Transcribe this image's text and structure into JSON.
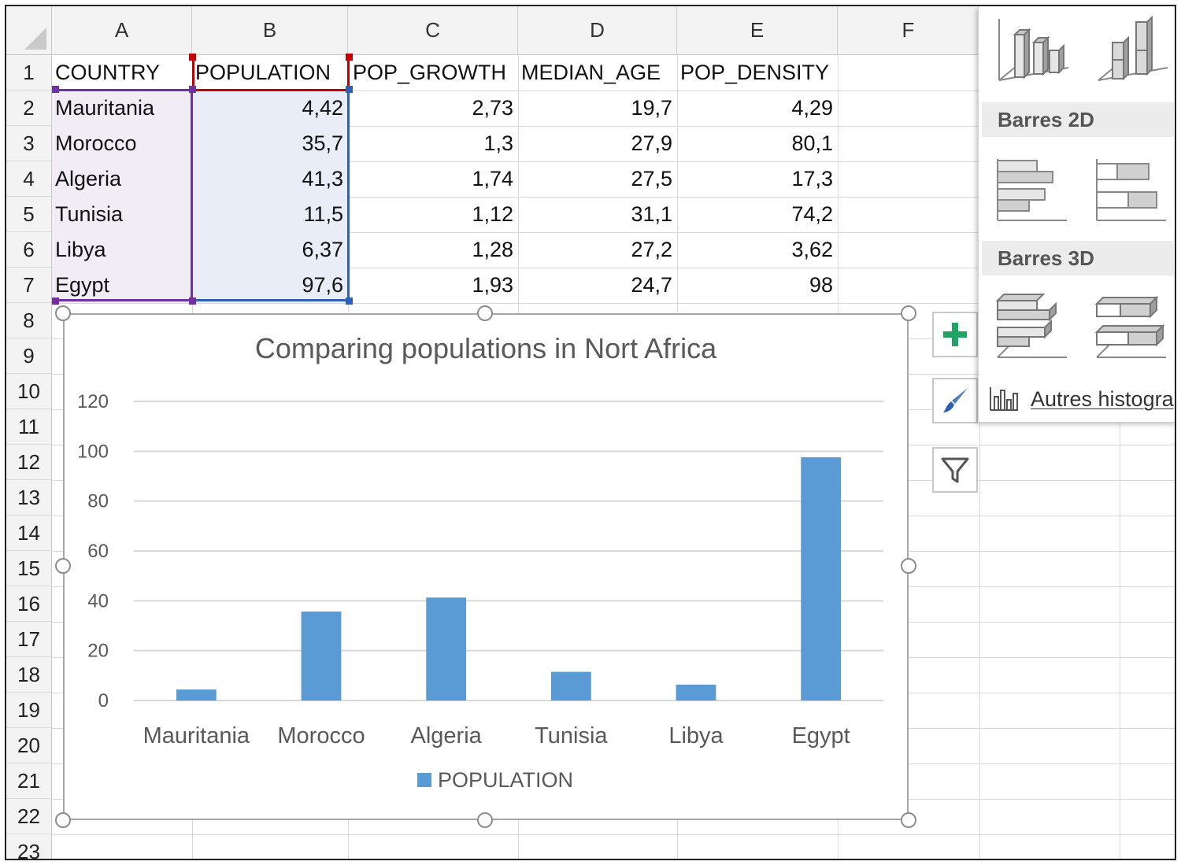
{
  "sheet": {
    "columns": [
      "A",
      "B",
      "C",
      "D",
      "E",
      "F"
    ],
    "rows": [
      "1",
      "2",
      "3",
      "4",
      "5",
      "6",
      "7",
      "8",
      "9",
      "10",
      "11",
      "12",
      "13",
      "14",
      "15",
      "16",
      "17",
      "18",
      "19",
      "20",
      "21",
      "22",
      "23"
    ],
    "headers": [
      "COUNTRY",
      "POPULATION",
      "POP_GROWTH",
      "MEDIAN_AGE",
      "POP_DENSITY"
    ],
    "data": [
      [
        "Mauritania",
        "4,42",
        "2,73",
        "19,7",
        "4,29"
      ],
      [
        "Morocco",
        "35,7",
        "1,3",
        "27,9",
        "80,1"
      ],
      [
        "Algeria",
        "41,3",
        "1,74",
        "27,5",
        "17,3"
      ],
      [
        "Tunisia",
        "11,5",
        "1,12",
        "31,1",
        "74,2"
      ],
      [
        "Libya",
        "6,37",
        "1,28",
        "27,2",
        "3,62"
      ],
      [
        "Egypt",
        "97,6",
        "1,93",
        "24,7",
        "98"
      ]
    ]
  },
  "chart_data": {
    "type": "bar",
    "title": "Comparing populations in Nort Africa",
    "categories": [
      "Mauritania",
      "Morocco",
      "Algeria",
      "Tunisia",
      "Libya",
      "Egypt"
    ],
    "series": [
      {
        "name": "POPULATION",
        "values": [
          4.42,
          35.7,
          41.3,
          11.5,
          6.37,
          97.6
        ]
      }
    ],
    "ylim": [
      0,
      120
    ],
    "yticks": [
      "0",
      "20",
      "40",
      "60",
      "80",
      "100",
      "120"
    ],
    "xlabel": "",
    "ylabel": "",
    "grid": true,
    "legend": "bottom",
    "bar_color": "#5b9bd5"
  },
  "chart_tools": {
    "add_element_icon": "plus-icon",
    "style_icon": "paintbrush-icon",
    "filter_icon": "filter-icon"
  },
  "gallery": {
    "section_2d": "Barres 2D",
    "section_3d": "Barres 3D",
    "more_label": "Autres histogra",
    "more_label_underline": "A"
  },
  "colors": {
    "selection_country": "#7030a0",
    "selection_population": "#2e5fb5",
    "selection_header": "#c00000",
    "plus_icon": "#21a366"
  }
}
